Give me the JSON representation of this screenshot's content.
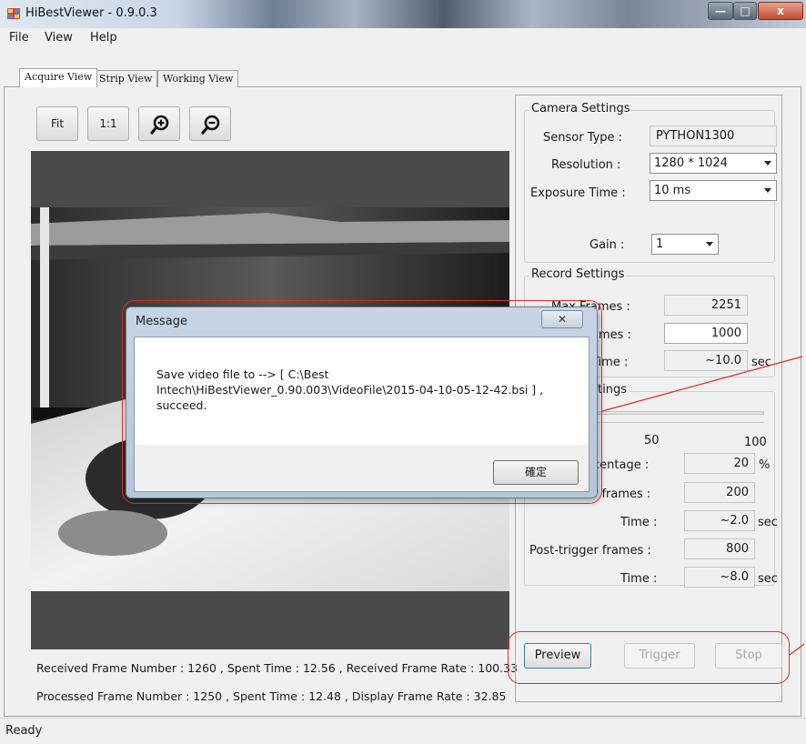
{
  "window": {
    "title": "HiBestViewer - 0.9.0.3",
    "min_glyph": "—",
    "max_glyph": "□",
    "close_glyph": "x"
  },
  "menu": [
    "File",
    "View",
    "Help"
  ],
  "tabs": [
    "Acquire View",
    "Strip View",
    "Working View"
  ],
  "toolbar": {
    "fit": "Fit",
    "one_to_one": "1:1",
    "zoom_in_icon": "zoom-in-icon",
    "zoom_out_icon": "zoom-out-icon"
  },
  "status_lines": {
    "received": "Received Frame Number : 1260 , Spent Time : 12.56 , Received Frame Rate : 100.33",
    "processed": "Processed Frame Number : 1250 , Spent Time : 12.48 ,  Display Frame Rate : 32.85"
  },
  "camera_settings": {
    "title": "Camera Settings",
    "sensor_type_label": "Sensor Type :",
    "sensor_type_value": "PYTHON1300",
    "resolution_label": "Resolution :",
    "resolution_value": "1280 * 1024",
    "exposure_label": "Exposure Time :",
    "exposure_value": "10 ms",
    "gain_label": "Gain :",
    "gain_value": "1"
  },
  "record_settings": {
    "title": "Record Settings",
    "max_frames_label": "Max Frames :",
    "max_frames_value": "2251",
    "frames_label": "ames :",
    "frames_value": "1000",
    "time_label": "Time :",
    "time_value": "~10.0",
    "time_unit": "sec"
  },
  "trigger_settings": {
    "title_partial": "ttings",
    "scale_mid": "50",
    "scale_max": "100",
    "percentage_label": "centage :",
    "percentage_value": "20",
    "percentage_unit": "%",
    "pre_frames_label": "r frames :",
    "pre_frames_value": "200",
    "pre_time_label": "Time :",
    "pre_time_value": "~2.0",
    "pre_time_unit": "sec",
    "post_frames_label": "Post-trigger frames :",
    "post_frames_value": "800",
    "post_time_label": "Time :",
    "post_time_value": "~8.0",
    "post_time_unit": "sec"
  },
  "actions": {
    "preview": "Preview",
    "trigger": "Trigger",
    "stop": "Stop"
  },
  "statusbar": "Ready",
  "dialog": {
    "title": "Message",
    "close_glyph": "✕",
    "message": "Save video file to --> [ C:\\Best Intech\\HiBestViewer_0.90.003\\VideoFile\\2015-04-10-05-12-42.bsi ] , succeed.",
    "ok": "確定"
  },
  "colors": {
    "annotation_red": "#d6322a",
    "image_background": "#4b4b4b"
  }
}
